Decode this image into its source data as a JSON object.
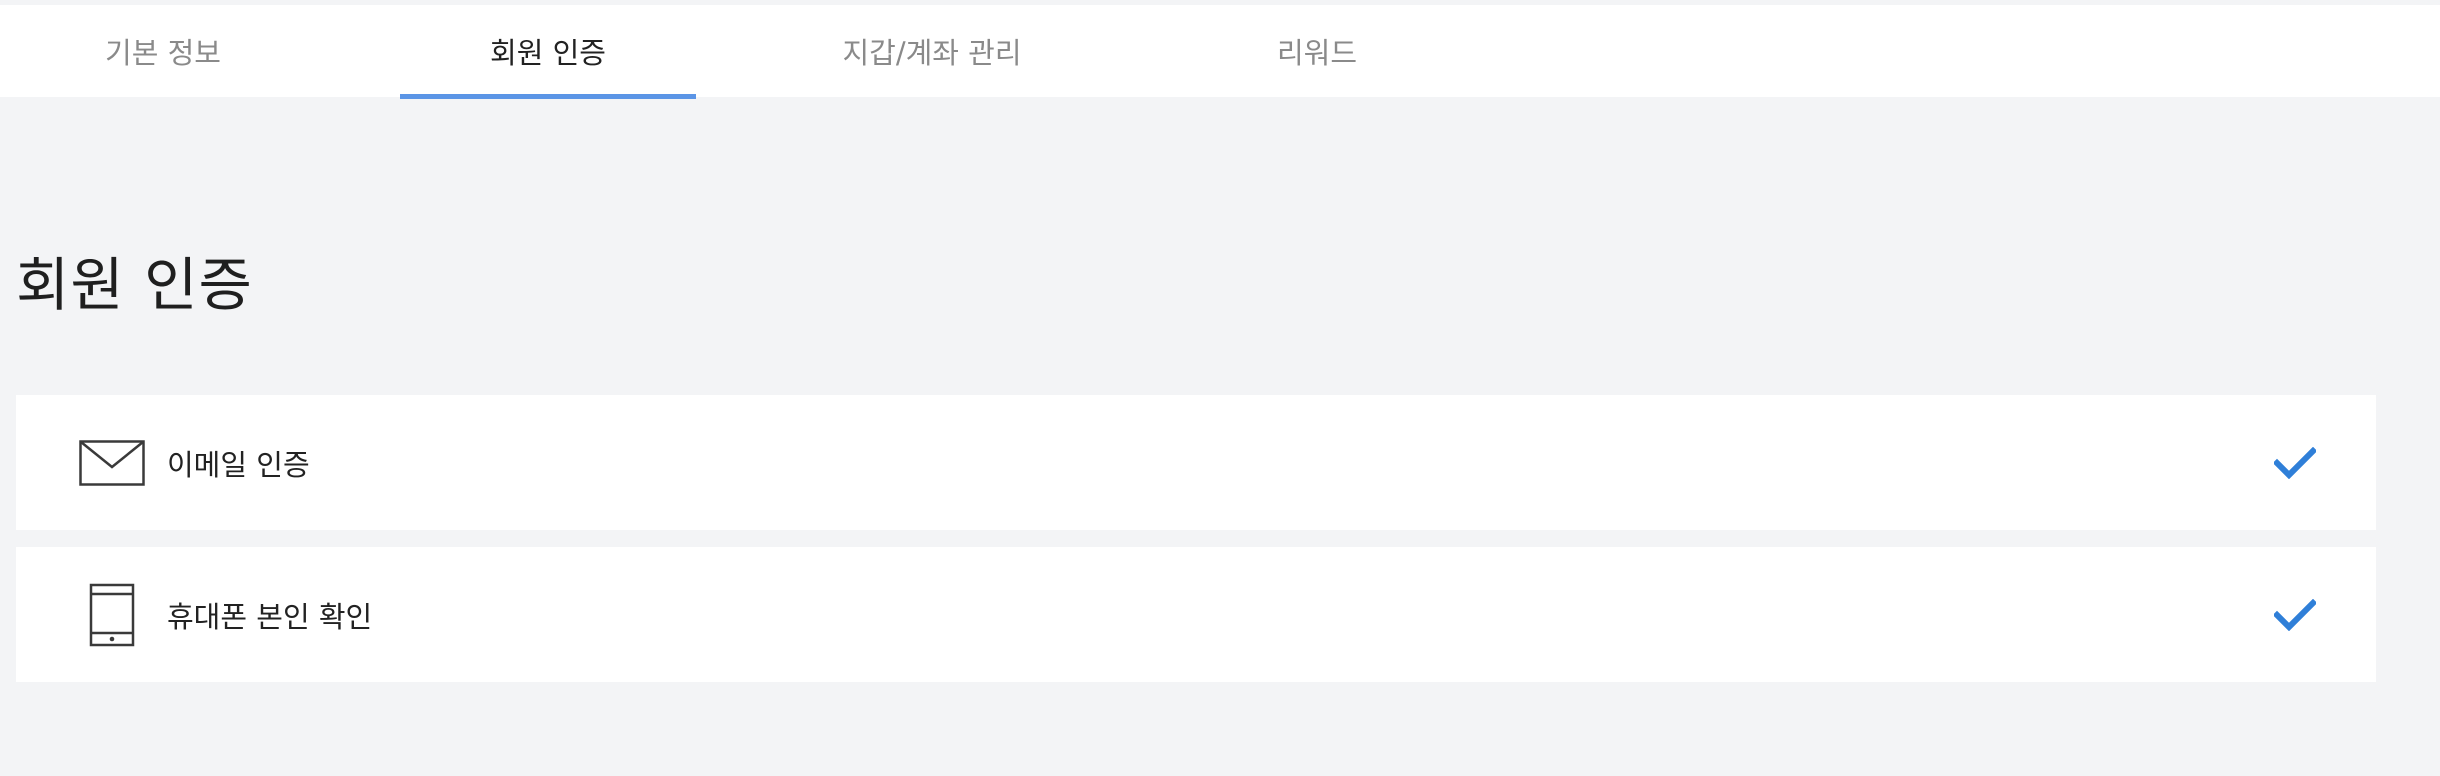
{
  "tabs": [
    {
      "label": "기본 정보",
      "active": false
    },
    {
      "label": "회원 인증",
      "active": true
    },
    {
      "label": "지갑/계좌 관리",
      "active": false
    },
    {
      "label": "리워드",
      "active": false
    }
  ],
  "colors": {
    "accent": "#5b95e6",
    "check": "#2f7fd8",
    "background": "#f3f4f6"
  },
  "section": {
    "title": "회원 인증"
  },
  "verifications": [
    {
      "label": "이메일 인증",
      "icon": "envelope-icon",
      "status_icon": "checkmark-icon",
      "verified": true
    },
    {
      "label": "휴대폰 본인 확인",
      "icon": "mobile-phone-icon",
      "status_icon": "checkmark-icon",
      "verified": true
    }
  ]
}
